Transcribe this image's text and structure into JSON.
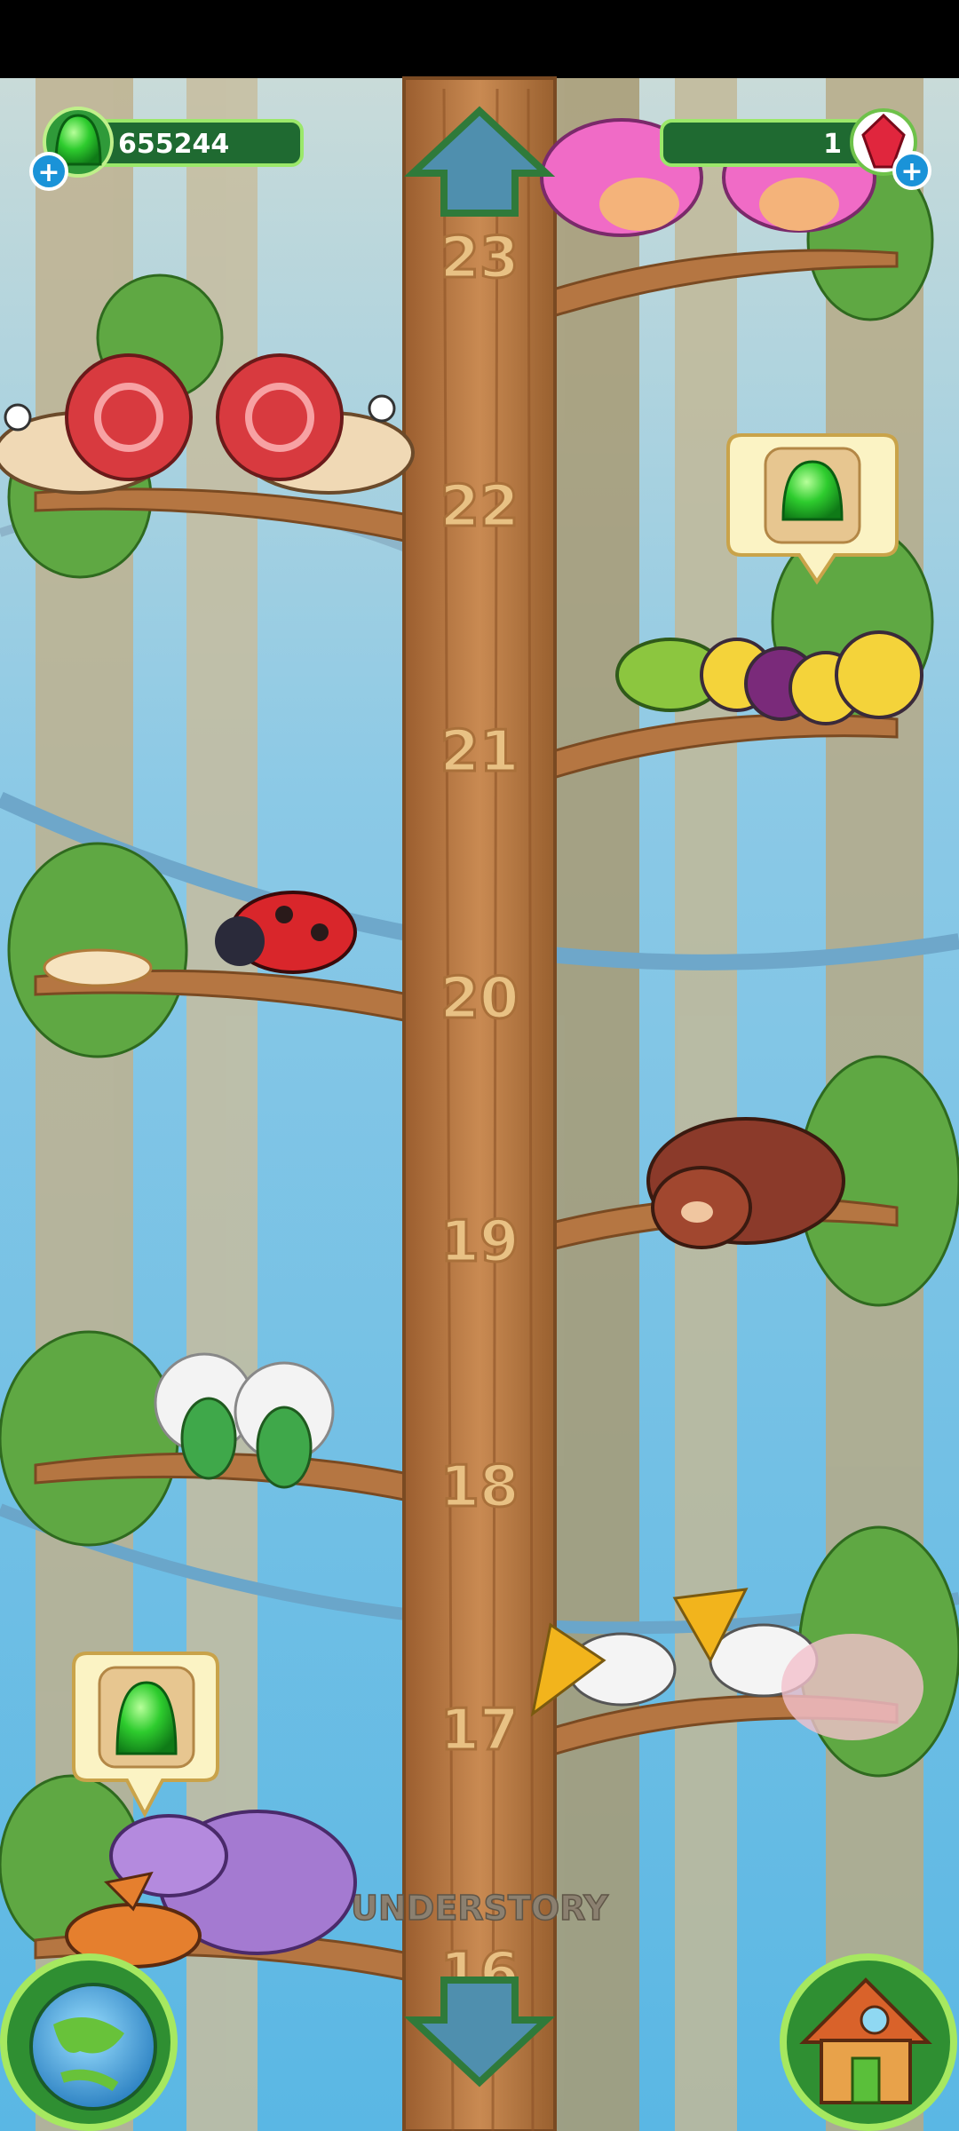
{
  "hud": {
    "gems": "655244",
    "rubies": "1"
  },
  "tree": {
    "levels": [
      "23",
      "22",
      "21",
      "20",
      "19",
      "18",
      "17",
      "16"
    ],
    "zone_label": "UNDERSTORY"
  },
  "colors": {
    "sky": "#7cc6e9",
    "trunk": "#b87a44",
    "leaf": "#5fa843",
    "hud_bar": "#1f6a31",
    "gem": "#22c22a"
  },
  "icons": [
    "gem-icon",
    "ruby-icon",
    "up-arrow-icon",
    "down-arrow-icon",
    "globe-icon",
    "house-icon"
  ]
}
